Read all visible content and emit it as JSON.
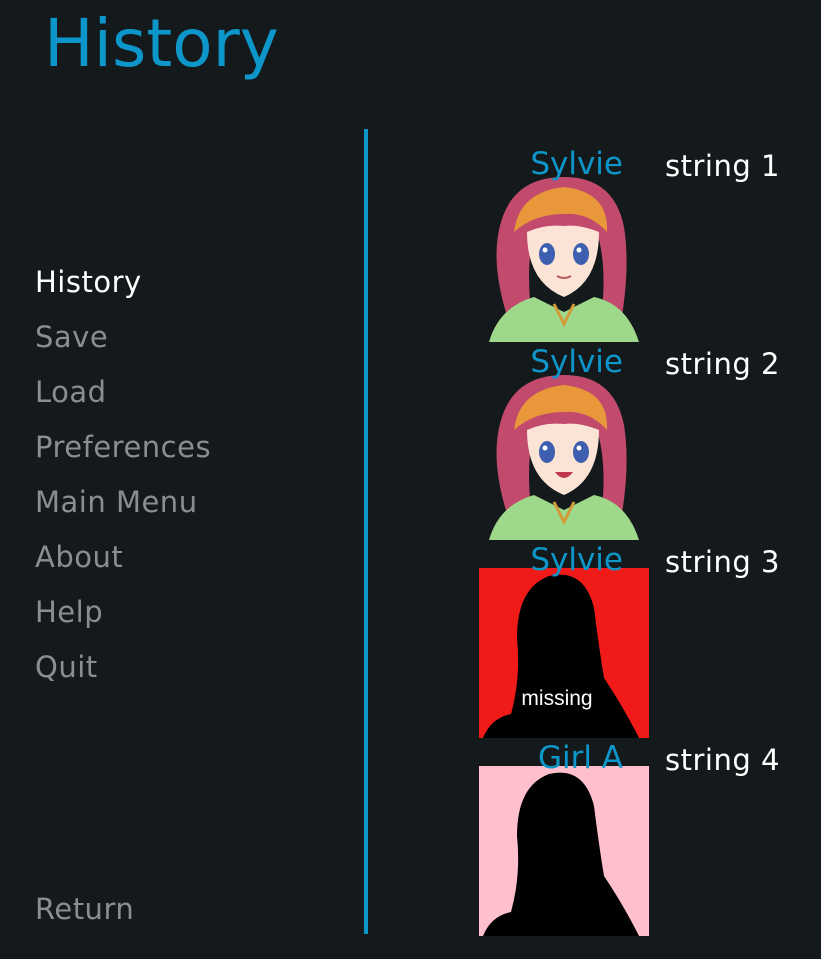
{
  "screen": {
    "title": "History"
  },
  "nav": {
    "items": [
      {
        "label": "History"
      },
      {
        "label": "Save"
      },
      {
        "label": "Load"
      },
      {
        "label": "Preferences"
      },
      {
        "label": "Main Menu"
      },
      {
        "label": "About"
      },
      {
        "label": "Help"
      },
      {
        "label": "Quit"
      }
    ],
    "active": "History",
    "return_label": "Return"
  },
  "history": [
    {
      "speaker": "Sylvie",
      "text": "string 1",
      "portrait": "sylvie-smiling-portrait"
    },
    {
      "speaker": "Sylvie",
      "text": "string 2",
      "portrait": "sylvie-laughing-portrait"
    },
    {
      "speaker": "Sylvie",
      "text": "string 3",
      "portrait": "missing-image-placeholder",
      "placeholder_text": "missing"
    },
    {
      "speaker": "Girl A",
      "text": "string 4",
      "portrait": "silhouette-placeholder"
    }
  ],
  "colors": {
    "background": "#141a1c",
    "accent": "#0d96c9",
    "nav_inactive": "#8b8d8e",
    "nav_active": "#ffffff",
    "missing_bg": "#f01a19",
    "silhouette_bg": "#ffbfcc"
  }
}
